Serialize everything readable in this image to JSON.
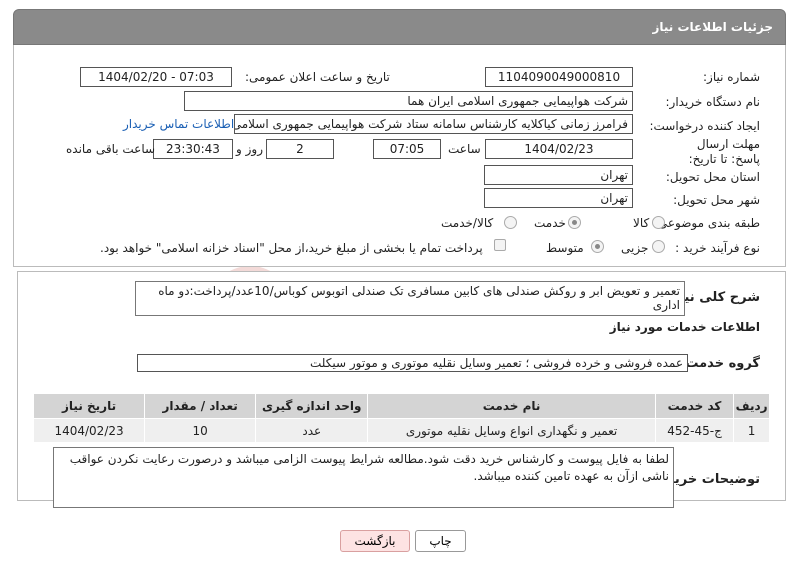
{
  "header": {
    "title": "جزئیات اطلاعات نیاز"
  },
  "need_number": {
    "label": "شماره نیاز:",
    "value": "1104090049000810"
  },
  "announce": {
    "label": "تاریخ و ساعت اعلان عمومی:",
    "value": "1404/02/20 - 07:03"
  },
  "buyer": {
    "label": "نام دستگاه خریدار:",
    "value": "شرکت هواپیمایی جمهوری اسلامی ایران هما"
  },
  "creator": {
    "label": "ایجاد کننده درخواست:",
    "value": "فرامرز زمانی کیاکلایه کارشناس سامانه ستاد شرکت هواپیمایی جمهوری اسلامی ایران هما",
    "contact_link": "اطلاعات تماس خریدار"
  },
  "deadline": {
    "label": "مهلت ارسال پاسخ: تا تاریخ:",
    "date": "1404/02/23",
    "time_label": "ساعت",
    "time": "07:05",
    "days": "2",
    "days_label": "روز و",
    "remaining": "23:30:43",
    "remaining_label": "ساعت باقی مانده"
  },
  "province": {
    "label": "استان محل تحویل:",
    "value": "تهران"
  },
  "city": {
    "label": "شهر محل تحویل:",
    "value": "تهران"
  },
  "category": {
    "label": "طبقه بندی موضوعی:",
    "options": [
      "کالا",
      "خدمت",
      "کالا/خدمت"
    ],
    "selected": "خدمت"
  },
  "process": {
    "label": "نوع فرآیند خرید :",
    "options": [
      "جزیی",
      "متوسط"
    ],
    "selected": "متوسط",
    "note": "پرداخت تمام یا بخشی از مبلغ خرید،از محل \"اسناد خزانه اسلامی\" خواهد بود."
  },
  "summary": {
    "label": "شرح کلی نیاز:",
    "value": "تعمیر و تعویض ابر و روکش صندلی های کابین مسافری تک صندلی اتوبوس کوباس/10عدد/پرداخت:دو ماه اداری"
  },
  "services": {
    "title": "اطلاعات خدمات مورد نیاز",
    "group_label": "گروه خدمت:",
    "group_value": "عمده فروشی و خرده فروشی ؛ تعمیر وسایل نقلیه موتوری و موتور سیکلت"
  },
  "table": {
    "headers": [
      "ردیف",
      "کد خدمت",
      "نام خدمت",
      "واحد اندازه گیری",
      "تعداد / مقدار",
      "تاریخ نیاز"
    ],
    "rows": [
      [
        "1",
        "ج-45-452",
        "تعمیر و نگهداری انواع وسایل نقلیه موتوری",
        "عدد",
        "10",
        "1404/02/23"
      ]
    ]
  },
  "buyer_notes": {
    "label": "توضیحات خریدار:",
    "value": "لطفا به فایل پیوست و کارشناس خرید دقت شود.مطالعه شرایط پیوست الزامی میباشد و درصورت رعایت نکردن عواقب ناشی ازآن به عهده تامین کننده میباشد."
  },
  "buttons": {
    "print": "چاپ",
    "back": "بازگشت"
  },
  "watermark": {
    "text": "AriaTender.net"
  },
  "colors": {
    "header_bg": "#8a8a8a",
    "back_btn_bg": "#fde3e3",
    "link": "#1a5fb4"
  }
}
